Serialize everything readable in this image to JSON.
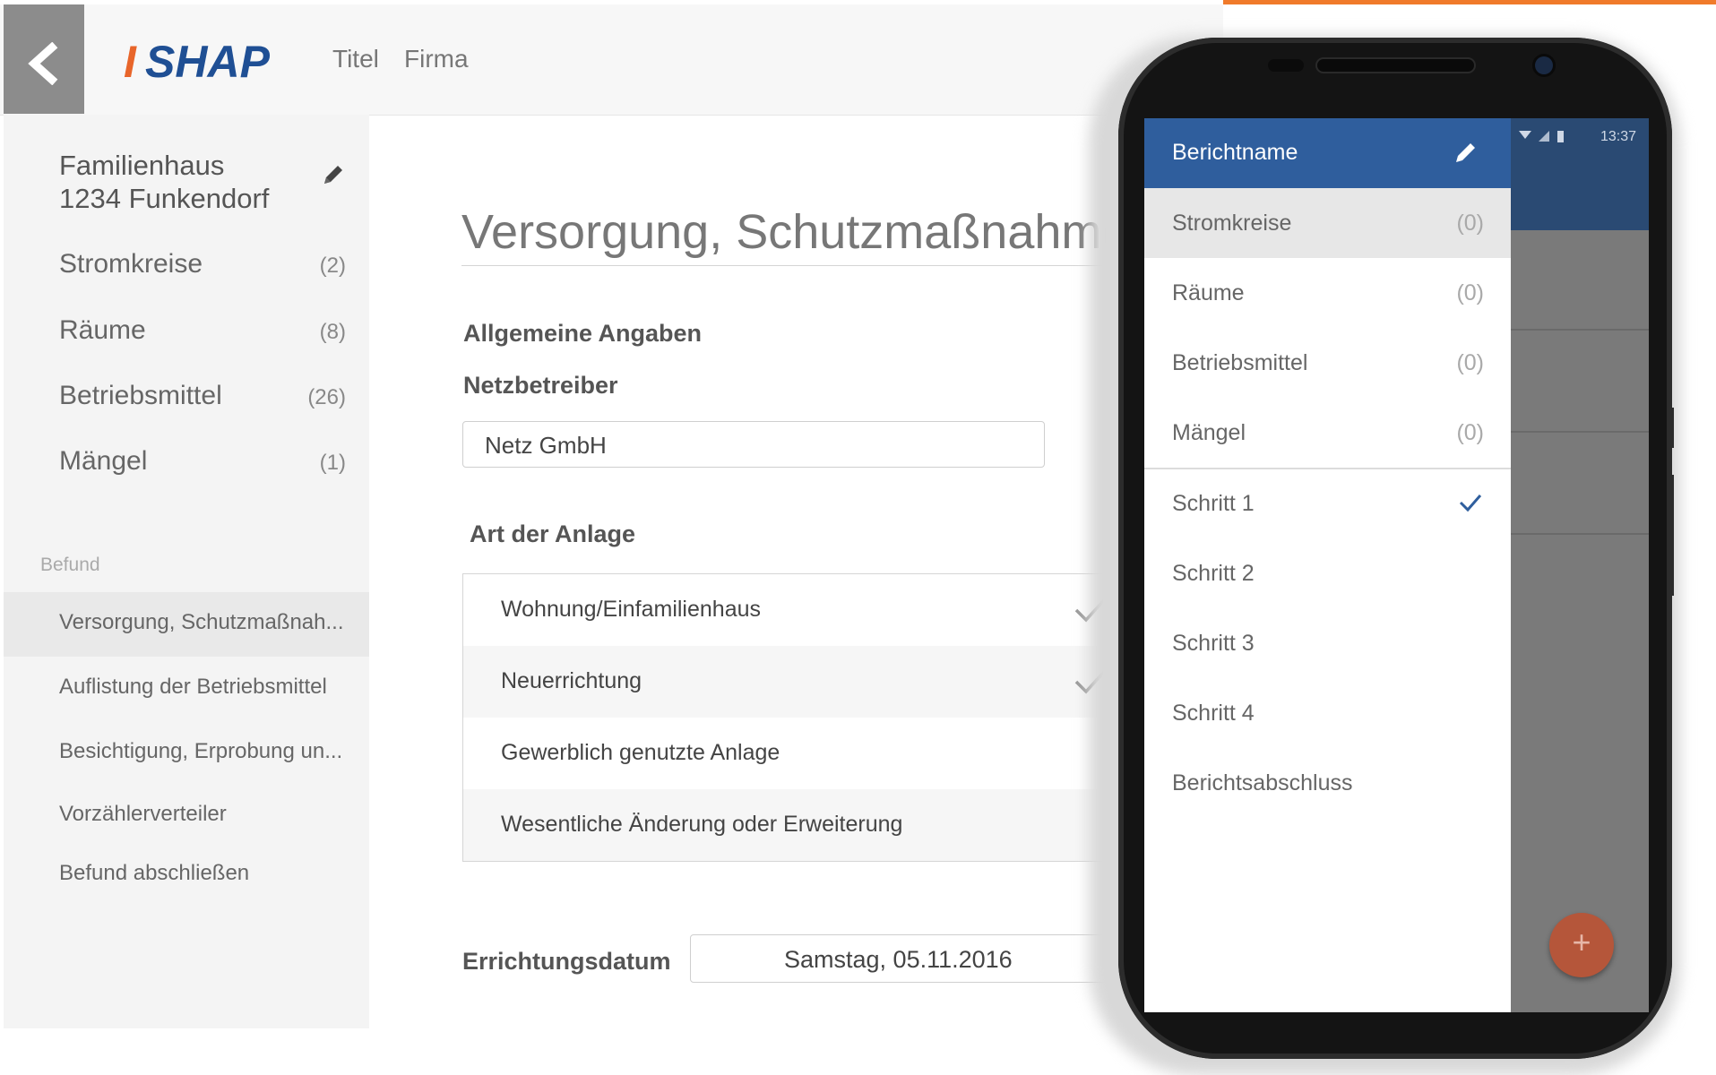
{
  "header": {
    "logo_text": "ISHAP",
    "links": [
      "Titel",
      "Firma"
    ]
  },
  "sidebar": {
    "project_title_line1": "Familienhaus",
    "project_title_line2": "1234 Funkendorf",
    "items": [
      {
        "label": "Stromkreise",
        "count": "(2)"
      },
      {
        "label": "Räume",
        "count": "(8)"
      },
      {
        "label": "Betriebsmittel",
        "count": "(26)"
      },
      {
        "label": "Mängel",
        "count": "(1)"
      }
    ],
    "section_label": "Befund",
    "sub_items": [
      {
        "label": "Versorgung, Schutzmaßnah..."
      },
      {
        "label": "Auflistung der Betriebsmittel"
      },
      {
        "label": "Besichtigung, Erprobung un..."
      },
      {
        "label": "Vorzählerverteiler"
      },
      {
        "label": "Befund abschließen"
      }
    ]
  },
  "main": {
    "title": "Versorgung, Schutzmaßnahme",
    "general_heading": "Allgemeine Angaben",
    "operator_label": "Netzbetreiber",
    "operator_value": "Netz GmbH",
    "facility_heading": "Art der Anlage",
    "options": [
      {
        "label": "Wohnung/Einfamilienhaus",
        "checked": true
      },
      {
        "label": "Neuerrichtung",
        "checked": true
      },
      {
        "label": "Gewerblich genutzte Anlage",
        "checked": false
      },
      {
        "label": "Wesentliche Änderung oder Erweiterung",
        "checked": false
      }
    ],
    "date_label": "Errichtungsdatum",
    "date_value": "Samstag, 05.11.2016"
  },
  "phone": {
    "status_time": "13:37",
    "drawer_title": "Berichtname",
    "counted_items": [
      {
        "label": "Stromkreise",
        "count": "(0)"
      },
      {
        "label": "Räume",
        "count": "(0)"
      },
      {
        "label": "Betriebsmittel",
        "count": "(0)"
      },
      {
        "label": "Mängel",
        "count": "(0)"
      }
    ],
    "steps": [
      {
        "label": "Schritt 1",
        "done": true
      },
      {
        "label": "Schritt 2",
        "done": false
      },
      {
        "label": "Schritt 3",
        "done": false
      },
      {
        "label": "Schritt 4",
        "done": false
      },
      {
        "label": "Berichtsabschluss",
        "done": false
      }
    ],
    "fab_label": "+"
  },
  "colors": {
    "accent": "#f07a2a",
    "logo_orange": "#e8652a",
    "logo_blue": "#1f4f94",
    "drawer_header": "#2f5e9d",
    "fab": "#b5563a"
  }
}
